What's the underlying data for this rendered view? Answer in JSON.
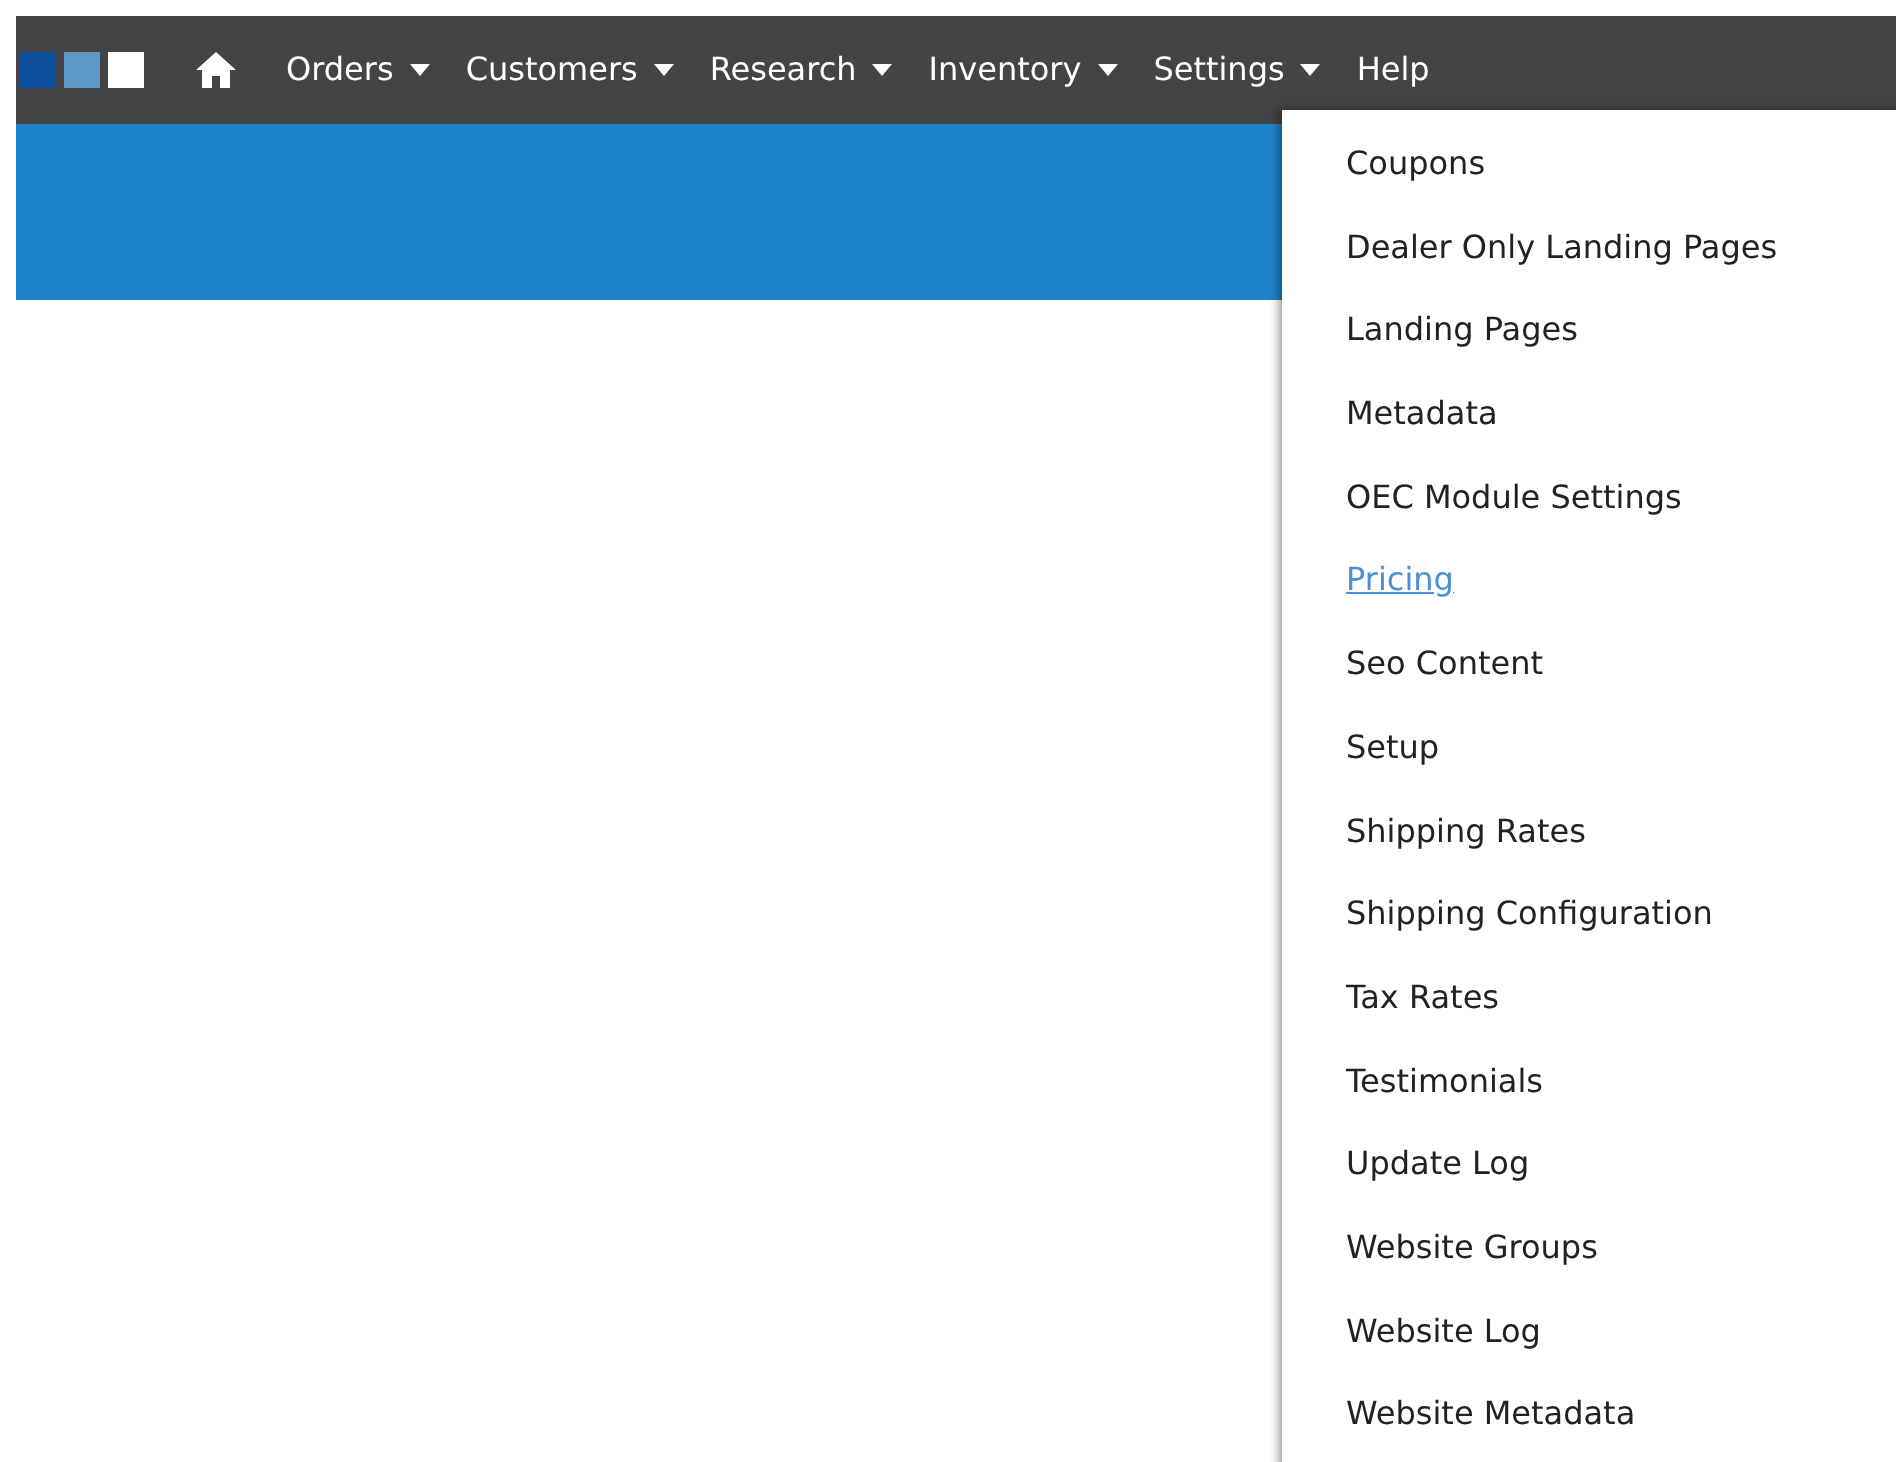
{
  "nav": {
    "items": [
      {
        "label": "Orders",
        "dropdown": true,
        "expanded": false
      },
      {
        "label": "Customers",
        "dropdown": true,
        "expanded": false
      },
      {
        "label": "Research",
        "dropdown": true,
        "expanded": false
      },
      {
        "label": "Inventory",
        "dropdown": true,
        "expanded": false
      },
      {
        "label": "Settings",
        "dropdown": true,
        "expanded": true
      },
      {
        "label": "Help",
        "dropdown": false,
        "expanded": false
      }
    ]
  },
  "settings_menu": {
    "items": [
      {
        "label": "Coupons",
        "hovered": false
      },
      {
        "label": "Dealer Only Landing Pages",
        "hovered": false
      },
      {
        "label": "Landing Pages",
        "hovered": false
      },
      {
        "label": "Metadata",
        "hovered": false
      },
      {
        "label": "OEC Module Settings",
        "hovered": false
      },
      {
        "label": "Pricing",
        "hovered": true
      },
      {
        "label": "Seo Content",
        "hovered": false
      },
      {
        "label": "Setup",
        "hovered": false
      },
      {
        "label": "Shipping Rates",
        "hovered": false
      },
      {
        "label": "Shipping Configuration",
        "hovered": false
      },
      {
        "label": "Tax Rates",
        "hovered": false
      },
      {
        "label": "Testimonials",
        "hovered": false
      },
      {
        "label": "Update Log",
        "hovered": false
      },
      {
        "label": "Website Groups",
        "hovered": false
      },
      {
        "label": "Website Log",
        "hovered": false
      },
      {
        "label": "Website Metadata",
        "hovered": false
      }
    ]
  }
}
